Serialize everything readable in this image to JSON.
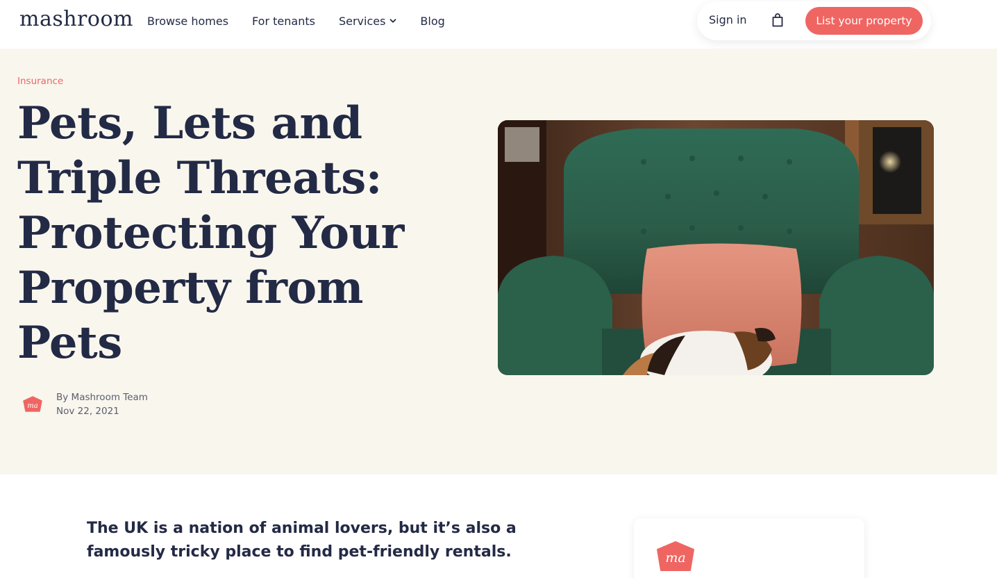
{
  "header": {
    "logo_text": "mashroom",
    "nav": [
      {
        "label": "Browse homes"
      },
      {
        "label": "For tenants"
      },
      {
        "label": "Services"
      },
      {
        "label": "Blog"
      }
    ],
    "sign_in_label": "Sign in",
    "cta_label": "List your property",
    "icons": [
      "chevron-down-icon",
      "shopping-bag-icon"
    ]
  },
  "hero": {
    "category": "Insurance",
    "title": "Pets, Lets and Triple Threats: Protecting Your Property from Pets",
    "author": "By Mashroom Team",
    "date": "Nov 22, 2021",
    "avatar_text": "ma",
    "image": "photo of cat sleeping on pink cushion on green velvet armchair"
  },
  "article": {
    "lead": "The UK is a nation of animal lovers, but it’s also a famously tricky place to find pet-friendly rentals."
  },
  "sidebar": {
    "avatar_text": "ma"
  },
  "colors": {
    "accent": "#ef6562",
    "navy": "#232a45",
    "hero_bg": "#f9f6ee"
  }
}
